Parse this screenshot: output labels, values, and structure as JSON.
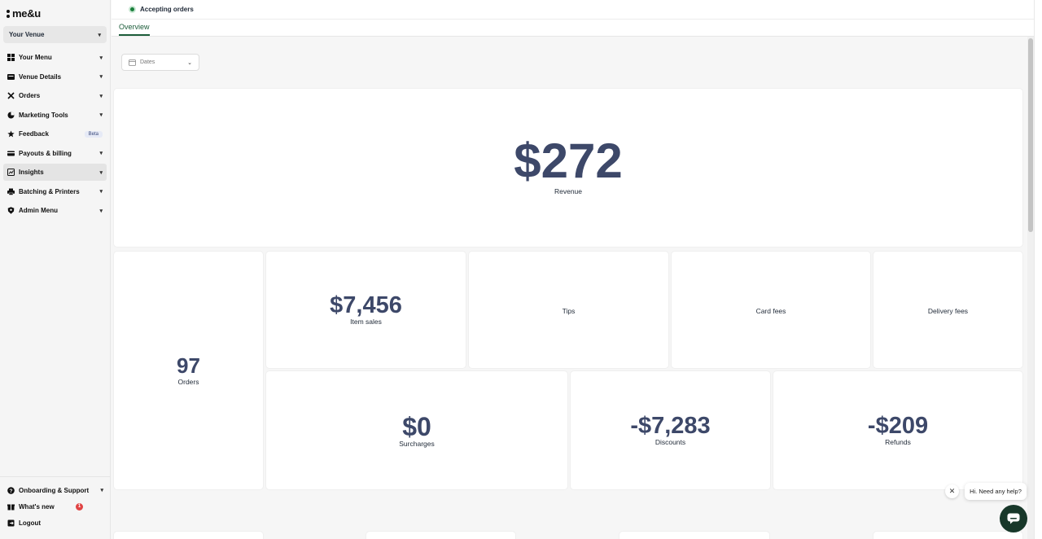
{
  "brand": {
    "logo_text": "me&u"
  },
  "sidebar": {
    "venue_label": "Your Venue",
    "items": [
      {
        "label": "Your Menu",
        "icon": "grid-icon"
      },
      {
        "label": "Venue Details",
        "icon": "store-icon"
      },
      {
        "label": "Orders",
        "icon": "utensils-icon"
      },
      {
        "label": "Marketing Tools",
        "icon": "pie-chart-icon"
      },
      {
        "label": "Feedback",
        "icon": "star-icon",
        "badge": "Beta"
      },
      {
        "label": "Payouts & billing",
        "icon": "card-icon"
      },
      {
        "label": "Insights",
        "icon": "chart-icon",
        "active": true
      },
      {
        "label": "Batching & Printers",
        "icon": "printer-icon"
      },
      {
        "label": "Admin Menu",
        "icon": "shield-icon"
      }
    ],
    "bottom": [
      {
        "label": "Onboarding & Support",
        "icon": "help-icon"
      },
      {
        "label": "What's new",
        "icon": "gift-icon",
        "badge": "1"
      },
      {
        "label": "Logout",
        "icon": "logout-icon"
      }
    ]
  },
  "topbar": {
    "status_text": "Accepting orders",
    "status_color": "#1a7f3c"
  },
  "tabs": [
    {
      "label": "Overview",
      "active": true
    }
  ],
  "filters": {
    "dates_placeholder": "Dates"
  },
  "metrics": {
    "revenue": {
      "value": "$272",
      "label": "Revenue"
    },
    "orders": {
      "value": "97",
      "label": "Orders"
    },
    "item_sales": {
      "value": "$7,456",
      "label": "Item sales"
    },
    "tips": {
      "label": "Tips"
    },
    "card_fees": {
      "label": "Card fees"
    },
    "delivery_fees": {
      "label": "Delivery fees"
    },
    "surcharges": {
      "value": "$0",
      "label": "Surcharges"
    },
    "discounts": {
      "value": "-$7,283",
      "label": "Discounts"
    },
    "refunds": {
      "value": "-$209",
      "label": "Refunds"
    }
  },
  "help": {
    "bubble_text": "Hi. Need any help?"
  },
  "colors": {
    "accent": "#1c5d3a",
    "metric": "#3d4869",
    "help_button": "#18382a",
    "badge": "#e04343"
  }
}
